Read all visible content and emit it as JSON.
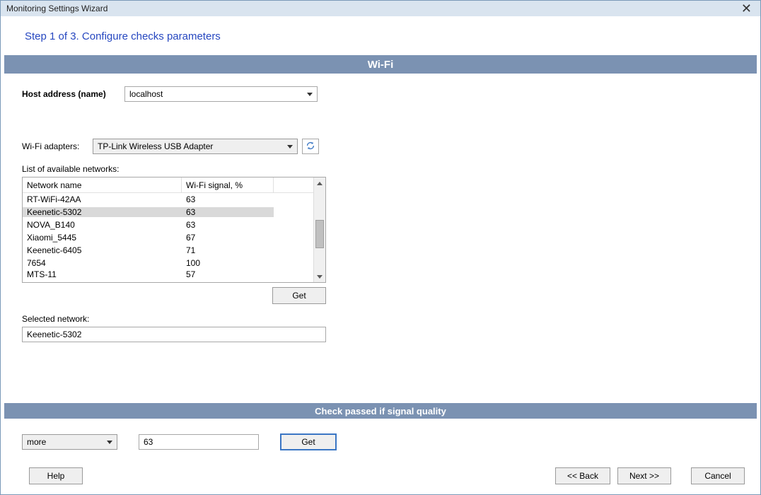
{
  "window": {
    "title": "Monitoring Settings Wizard"
  },
  "step": {
    "title": "Step 1 of 3. Configure checks parameters"
  },
  "section": {
    "wifi": "Wi-Fi",
    "check_bar": "Check passed if signal quality"
  },
  "host": {
    "label": "Host address (name)",
    "value": "localhost"
  },
  "adapters": {
    "label": "Wi-Fi adapters:",
    "value": "TP-Link Wireless USB Adapter"
  },
  "networks": {
    "label": "List of available networks:",
    "columns": {
      "name": "Network name",
      "signal": "Wi-Fi signal, %"
    },
    "rows": [
      {
        "name": "RT-WiFi-42AA",
        "signal": "63"
      },
      {
        "name": "Keenetic-5302",
        "signal": "63"
      },
      {
        "name": "NOVA_B140",
        "signal": "63"
      },
      {
        "name": "Xiaomi_5445",
        "signal": "67"
      },
      {
        "name": "Keenetic-6405",
        "signal": "71"
      },
      {
        "name": "7654",
        "signal": "100"
      },
      {
        "name": "MTS-11",
        "signal": "57"
      }
    ],
    "selected_index": 1,
    "get_btn": "Get"
  },
  "selected": {
    "label": "Selected network:",
    "value": "Keenetic-5302"
  },
  "threshold": {
    "comparator": "more",
    "value": "63",
    "get_btn": "Get"
  },
  "buttons": {
    "help": "Help",
    "back": "<< Back",
    "next": "Next >>",
    "cancel": "Cancel"
  }
}
